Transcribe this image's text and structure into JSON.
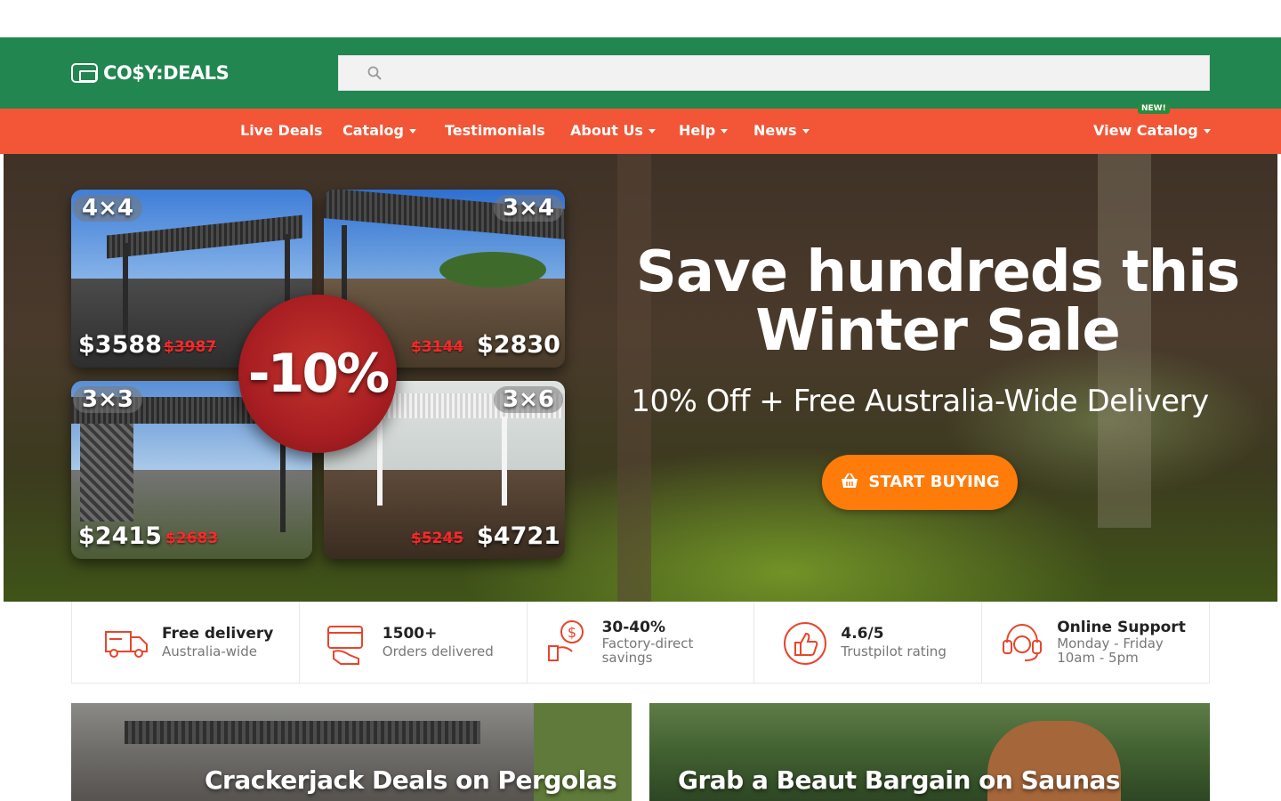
{
  "brand": {
    "name": "CO$Y:DEALS"
  },
  "search": {
    "placeholder": ""
  },
  "nav": {
    "items": [
      {
        "label": "Live Deals",
        "dropdown": false
      },
      {
        "label": "Catalog",
        "dropdown": true
      },
      {
        "label": "Testimonials",
        "dropdown": false
      },
      {
        "label": "About Us",
        "dropdown": true
      },
      {
        "label": "Help",
        "dropdown": true
      },
      {
        "label": "News",
        "dropdown": true
      }
    ],
    "view_catalog": {
      "label": "View Catalog",
      "badge": "NEW!"
    }
  },
  "hero": {
    "discount_badge": "-10%",
    "headline_line1": "Save hundreds this",
    "headline_line2": "Winter Sale",
    "subheadline": "10% Off + Free Australia-Wide Delivery",
    "cta_label": "START BUYING",
    "products": [
      {
        "size": "4×4",
        "price": "$3588",
        "old_price": "$3987"
      },
      {
        "size": "3×4",
        "price": "$2830",
        "old_price": "$3144"
      },
      {
        "size": "3×3",
        "price": "$2415",
        "old_price": "$2683"
      },
      {
        "size": "3×6",
        "price": "$4721",
        "old_price": "$5245"
      }
    ]
  },
  "features": [
    {
      "icon": "delivery-truck-icon",
      "title": "Free delivery",
      "subtitle": "Australia-wide"
    },
    {
      "icon": "card-hand-icon",
      "title": "1500+",
      "subtitle": "Orders delivered"
    },
    {
      "icon": "savings-hand-icon",
      "title": "30-40%",
      "subtitle": "Factory-direct\nsavings"
    },
    {
      "icon": "thumbs-up-icon",
      "title": "4.6/5",
      "subtitle": "Trustpilot rating"
    },
    {
      "icon": "headset-icon",
      "title": "Online Support",
      "subtitle": "Monday - Friday\n10am - 5pm"
    }
  ],
  "promos": [
    {
      "title": "Crackerjack Deals on Pergolas"
    },
    {
      "title": "Grab a Beaut Bargain on Saunas"
    }
  ],
  "colors": {
    "header_green": "#228651",
    "nav_orange": "#f25637",
    "cta_orange": "#ff7b0a",
    "icon_red": "#e8452c"
  }
}
